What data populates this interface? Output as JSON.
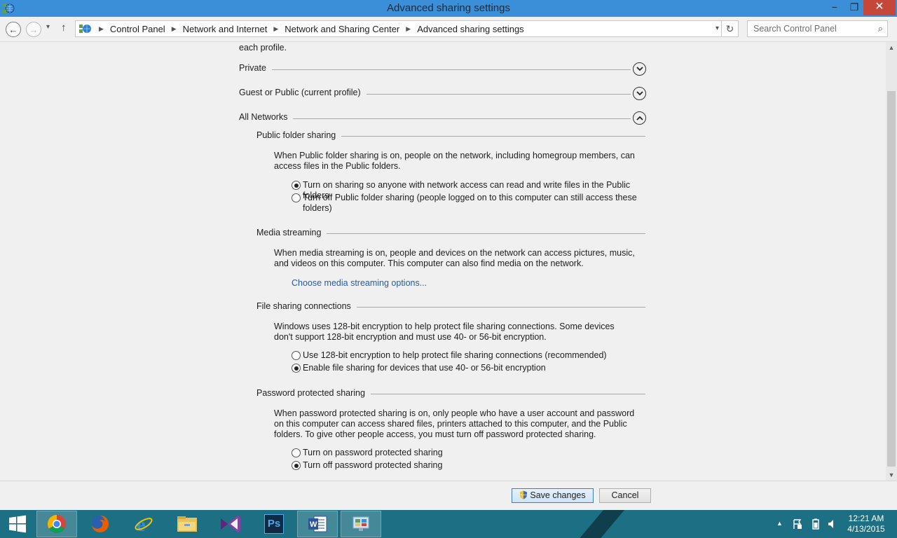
{
  "window": {
    "title": "Advanced sharing settings",
    "minimize": "−",
    "maximize": "❐",
    "close": "✕"
  },
  "navigation": {
    "back": "←",
    "forward": "→",
    "recent": "▾",
    "up": "↑",
    "breadcrumbs": [
      "Control Panel",
      "Network and Internet",
      "Network and Sharing Center",
      "Advanced sharing settings"
    ],
    "refresh": "↻",
    "search_placeholder": "Search Control Panel"
  },
  "content": {
    "intro_tail": "each profile.",
    "profiles": [
      {
        "label": "Private",
        "expanded": false
      },
      {
        "label": "Guest or Public (current profile)",
        "expanded": false
      },
      {
        "label": "All Networks",
        "expanded": true
      }
    ],
    "sections": {
      "public_folder": {
        "title": "Public folder sharing",
        "description": "When Public folder sharing is on, people on the network, including homegroup members, can access files in the Public folders.",
        "options": [
          {
            "label": "Turn on sharing so anyone with network access can read and write files in the Public folders",
            "checked": true
          },
          {
            "label": "Turn off Public folder sharing (people logged on to this computer can still access these folders)",
            "checked": false
          }
        ]
      },
      "media_streaming": {
        "title": "Media streaming",
        "description": "When media streaming is on, people and devices on the network can access pictures, music, and videos on this computer. This computer can also find media on the network.",
        "link": "Choose media streaming options..."
      },
      "file_sharing": {
        "title": "File sharing connections",
        "description": "Windows uses 128-bit encryption to help protect file sharing connections. Some devices don't support 128-bit encryption and must use 40- or 56-bit encryption.",
        "options": [
          {
            "label": "Use 128-bit encryption to help protect file sharing connections (recommended)",
            "checked": false
          },
          {
            "label": "Enable file sharing for devices that use 40- or 56-bit encryption",
            "checked": true
          }
        ]
      },
      "password_sharing": {
        "title": "Password protected sharing",
        "description": "When password protected sharing is on, only people who have a user account and password on this computer can access shared files, printers attached to this computer, and the Public folders. To give other people access, you must turn off password protected sharing.",
        "options": [
          {
            "label": "Turn on password protected sharing",
            "checked": false
          },
          {
            "label": "Turn off password protected sharing",
            "checked": true
          }
        ]
      }
    }
  },
  "buttons": {
    "save": "Save changes",
    "cancel": "Cancel"
  },
  "taskbar": {
    "apps": [
      "start-icon",
      "chrome-icon",
      "firefox-icon",
      "internet-explorer-icon",
      "file-explorer-icon",
      "visual-studio-icon",
      "photoshop-icon",
      "word-icon",
      "control-panel-icon"
    ],
    "photoshop_label": "Ps",
    "tray_arrow": "▲",
    "time": "12:21 AM",
    "date": "4/13/2015"
  },
  "colors": {
    "titlebar": "#3a8fd8",
    "close_button": "#c7463a",
    "taskbar": "#1d6f83",
    "link": "#1f5db0"
  }
}
